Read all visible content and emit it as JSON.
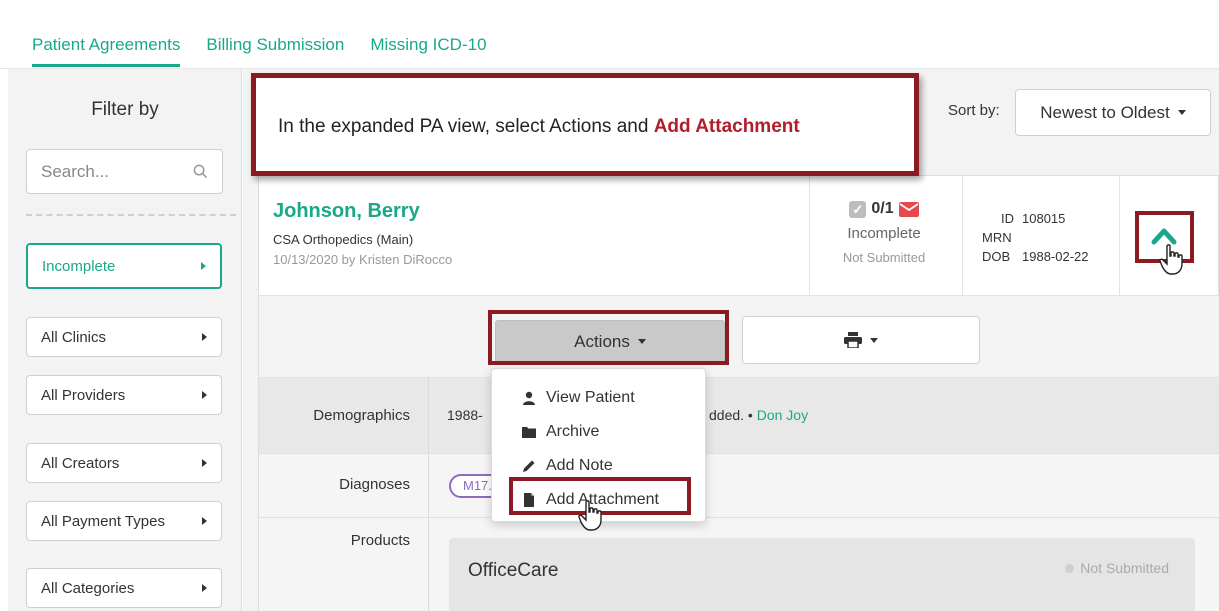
{
  "tabs": [
    "Patient Agreements",
    "Billing Submission",
    "Missing ICD-10"
  ],
  "sidebar": {
    "title": "Filter by",
    "search_placeholder": "Search...",
    "filters": [
      "Incomplete",
      "All Clinics",
      "All Providers",
      "All Creators",
      "All Payment Types",
      "All Categories"
    ]
  },
  "sort": {
    "label": "Sort by:",
    "value": "Newest to Oldest"
  },
  "callout": {
    "text": "In the expanded PA view, select Actions and ",
    "highlight": "Add Attachment"
  },
  "patient": {
    "name": "Johnson, Berry",
    "clinic": "CSA Orthopedics (Main)",
    "created": "10/13/2020 by Kristen DiRocco",
    "count": "0/1",
    "status": "Incomplete",
    "submission": "Not Submitted",
    "id_label": "ID",
    "id_value": "108015",
    "mrn_label": "MRN",
    "dob_label": "DOB",
    "dob_value": "1988-02-22"
  },
  "actions": {
    "label": "Actions",
    "menu": [
      "View Patient",
      "Archive",
      "Add Note",
      "Add Attachment"
    ]
  },
  "details": {
    "demographics_label": "Demographics",
    "demographics_value": "1988-",
    "demographics_tail": "dded. • ",
    "demographics_link": "Don Joy",
    "diagnoses_label": "Diagnoses",
    "diagnosis_pill": "M17.",
    "products_label": "Products",
    "product_name": "OfficeCare",
    "product_status": "Not Submitted"
  },
  "colors": {
    "accent": "#1aa88a",
    "annotation": "#8b1a22",
    "annotation_text": "#b01e2a"
  }
}
